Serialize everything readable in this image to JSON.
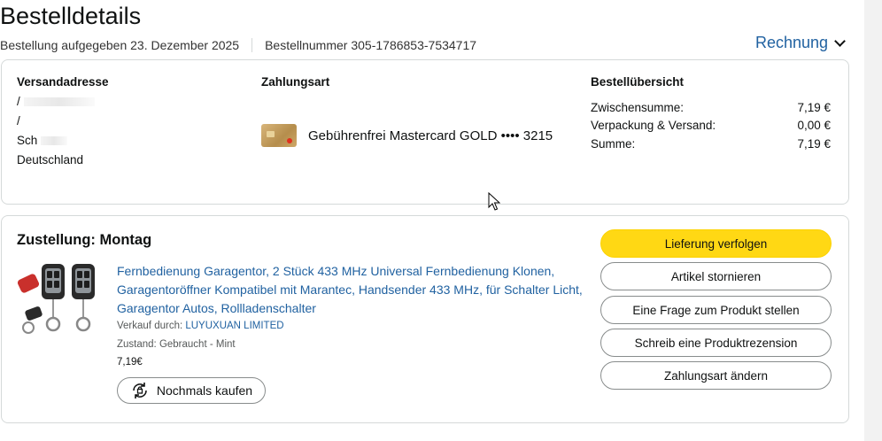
{
  "page": {
    "title": "Bestelldetails",
    "order_date": "Bestellung aufgegeben 23. Dezember 2025",
    "order_number": "Bestellnummer 305-1786853-7534717",
    "invoice_link": "Rechnung"
  },
  "shipping": {
    "heading": "Versandadresse",
    "lines": [
      "/",
      "/",
      "Sch",
      "Deutschland"
    ]
  },
  "payment": {
    "heading": "Zahlungsart",
    "method": "Gebührenfrei Mastercard GOLD •••• 3215"
  },
  "summary": {
    "heading": "Bestellübersicht",
    "rows": [
      {
        "label": "Zwischensumme:",
        "value": "7,19 €"
      },
      {
        "label": "Verpackung & Versand:",
        "value": "0,00 €"
      },
      {
        "label": "Summe:",
        "value": "7,19 €"
      }
    ]
  },
  "delivery": {
    "title": "Zustellung: Montag",
    "product_title": "Fernbedienung Garagentor, 2 Stück 433 MHz Universal Fernbedienung Klonen, Garagentoröffner Kompatibel mit Marantec, Handsender 433 MHz, für Schalter Licht, Garagentor Autos, Rollladenschalter",
    "seller_prefix": "Verkauf durch:",
    "seller_name": "LUYUXUAN LIMITED",
    "condition": "Zustand: Gebraucht - Mint",
    "price": "7,19€",
    "rebuy_label": "Nochmals kaufen"
  },
  "actions": [
    {
      "label": "Lieferung verfolgen"
    },
    {
      "label": "Artikel stornieren"
    },
    {
      "label": "Eine Frage zum Produkt stellen"
    },
    {
      "label": "Schreib eine Produktrezension"
    },
    {
      "label": "Zahlungsart ändern"
    }
  ],
  "colors": {
    "link": "#2162a1",
    "primary_button": "#ffd814",
    "border": "#d5d9d9"
  },
  "icons": {
    "invoice_chevron": "chevron-down-icon",
    "rebuy": "rebuy-icon",
    "card": "mastercard-icon"
  }
}
